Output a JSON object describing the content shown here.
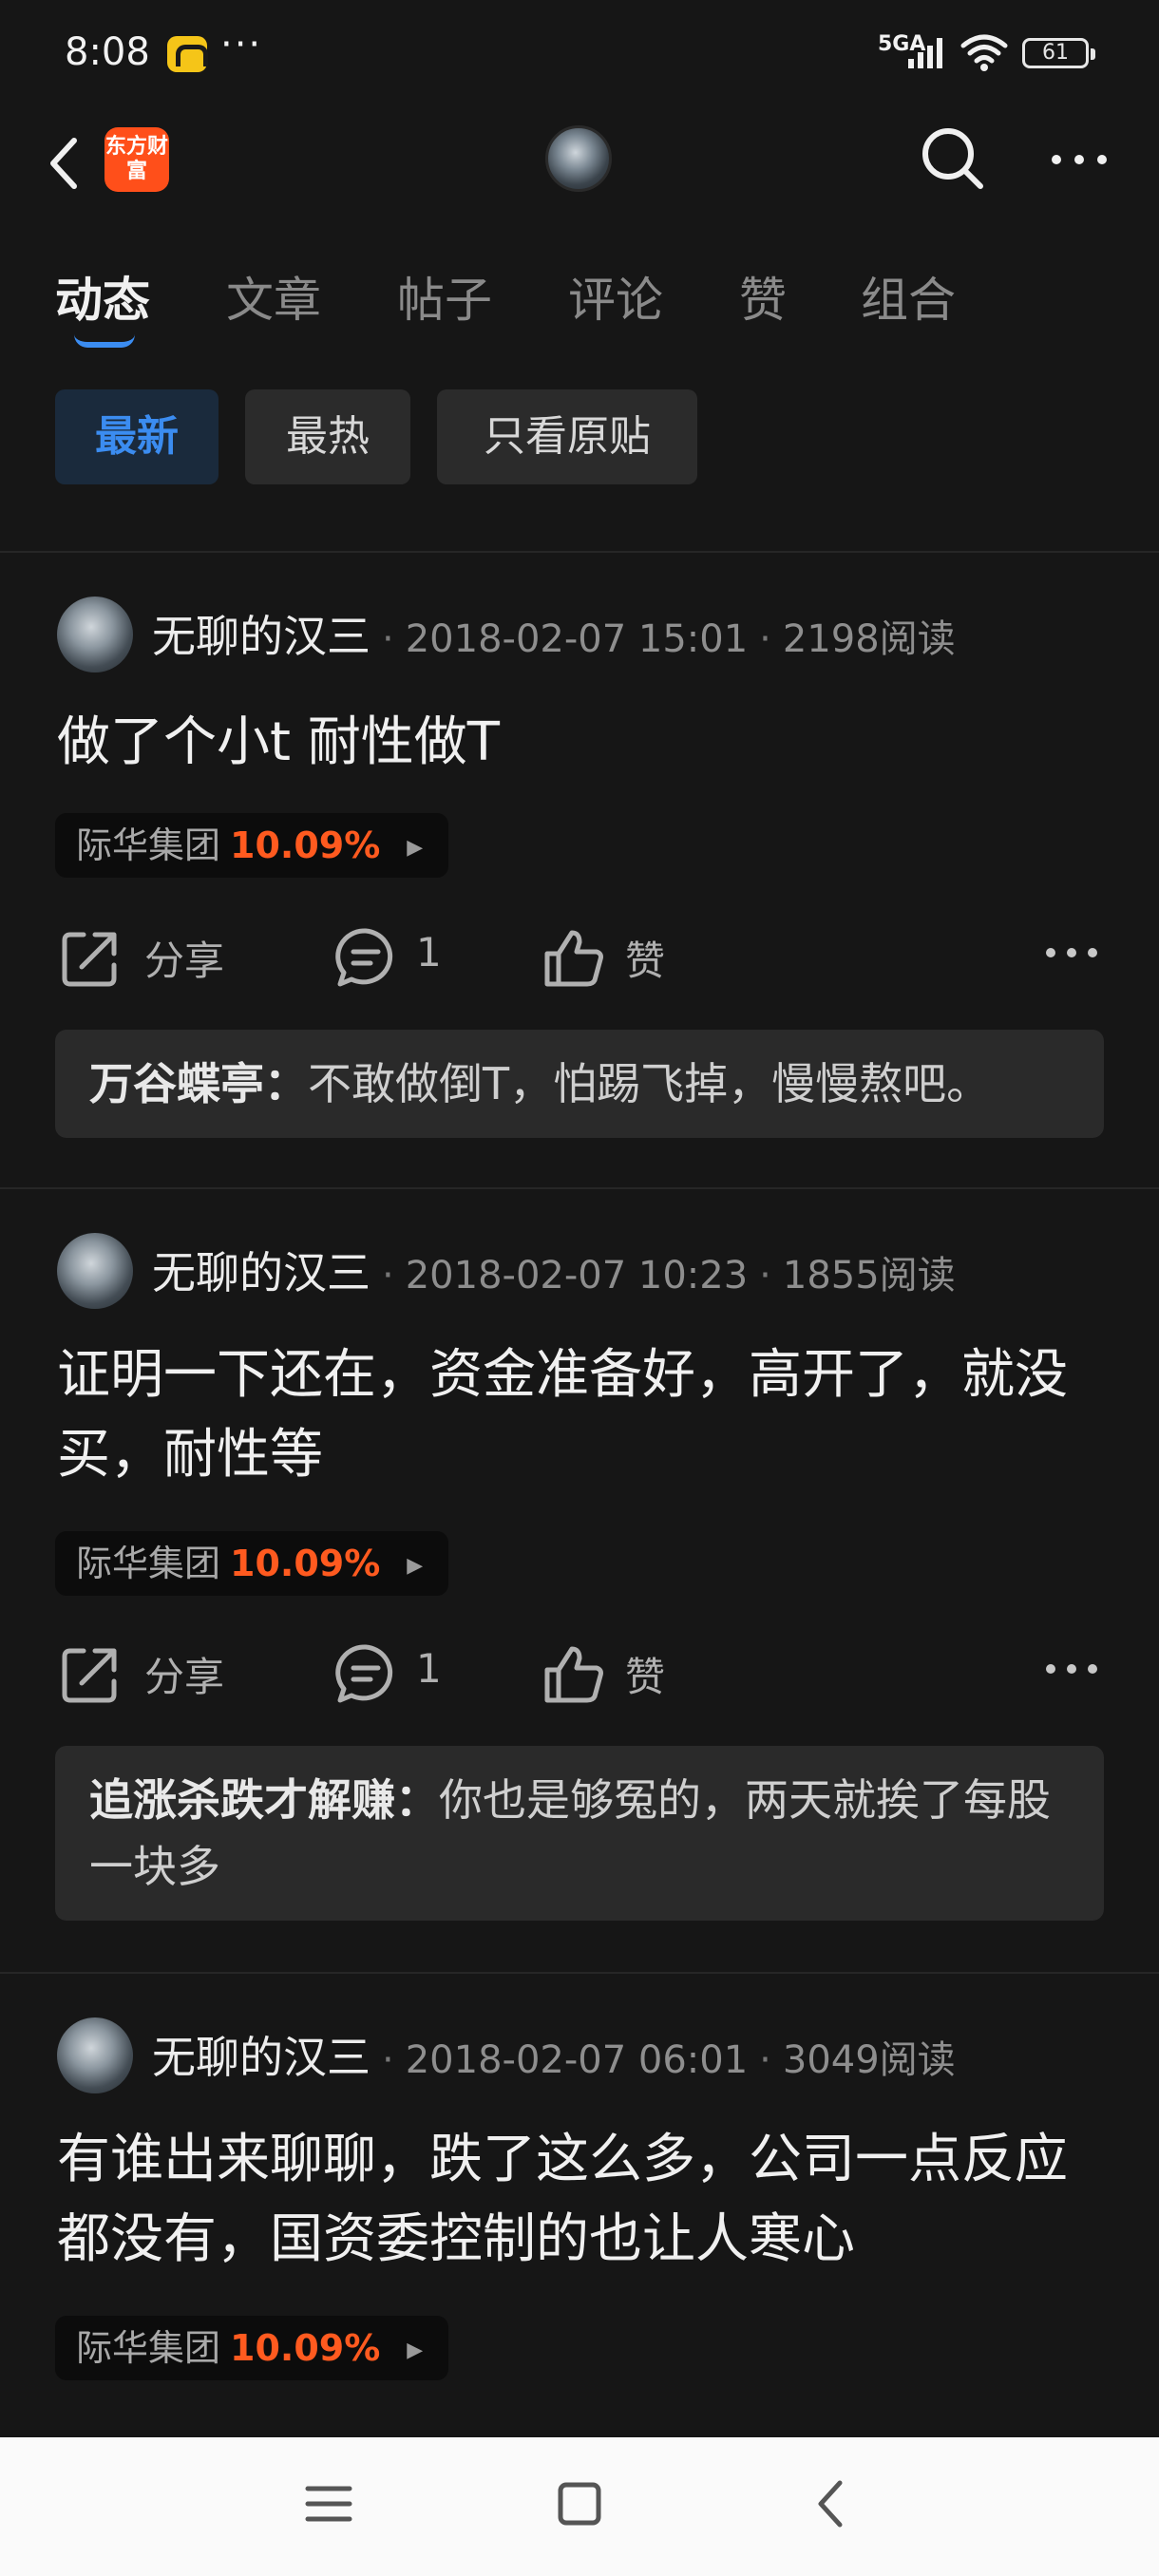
{
  "status_bar": {
    "time": "8:08",
    "dots": "···",
    "network": "5GA",
    "battery": "61"
  },
  "header": {
    "brand_logo_text": "东方财富",
    "accent_color": "#3b8cf0",
    "brand_color": "#ff4f1a"
  },
  "tabs": [
    {
      "label": "动态",
      "active": true
    },
    {
      "label": "文章",
      "active": false
    },
    {
      "label": "帖子",
      "active": false
    },
    {
      "label": "评论",
      "active": false
    },
    {
      "label": "赞",
      "active": false
    },
    {
      "label": "组合",
      "active": false
    }
  ],
  "filters": [
    {
      "label": "最新",
      "active": true
    },
    {
      "label": "最热",
      "active": false
    },
    {
      "label": "只看原贴",
      "active": false
    }
  ],
  "meta_separator": "·",
  "posts": [
    {
      "author": "无聊的汉三",
      "date": "2018-02-07 15:01",
      "reads": "2198阅读",
      "text": "做了个小t 耐性做T",
      "stock_name": "际华集团",
      "stock_change": "10.09%",
      "share_label": "分享",
      "comment_count": "1",
      "like_label": "赞",
      "comment_author": "万谷蝶亭：",
      "comment_text": "不敢做倒T，怕踢飞掉，慢慢熬吧。"
    },
    {
      "author": "无聊的汉三",
      "date": "2018-02-07 10:23",
      "reads": "1855阅读",
      "text": "证明一下还在，资金准备好，高开了，就没买，耐性等",
      "stock_name": "际华集团",
      "stock_change": "10.09%",
      "share_label": "分享",
      "comment_count": "1",
      "like_label": "赞",
      "comment_author": "追涨杀跌才解赚：",
      "comment_text": "你也是够冤的，两天就挨了每股一块多"
    },
    {
      "author": "无聊的汉三",
      "date": "2018-02-07 06:01",
      "reads": "3049阅读",
      "text": "有谁出来聊聊，跌了这么多，公司一点反应都没有，国资委控制的也让人寒心",
      "stock_name": "际华集团",
      "stock_change": "10.09%"
    }
  ]
}
